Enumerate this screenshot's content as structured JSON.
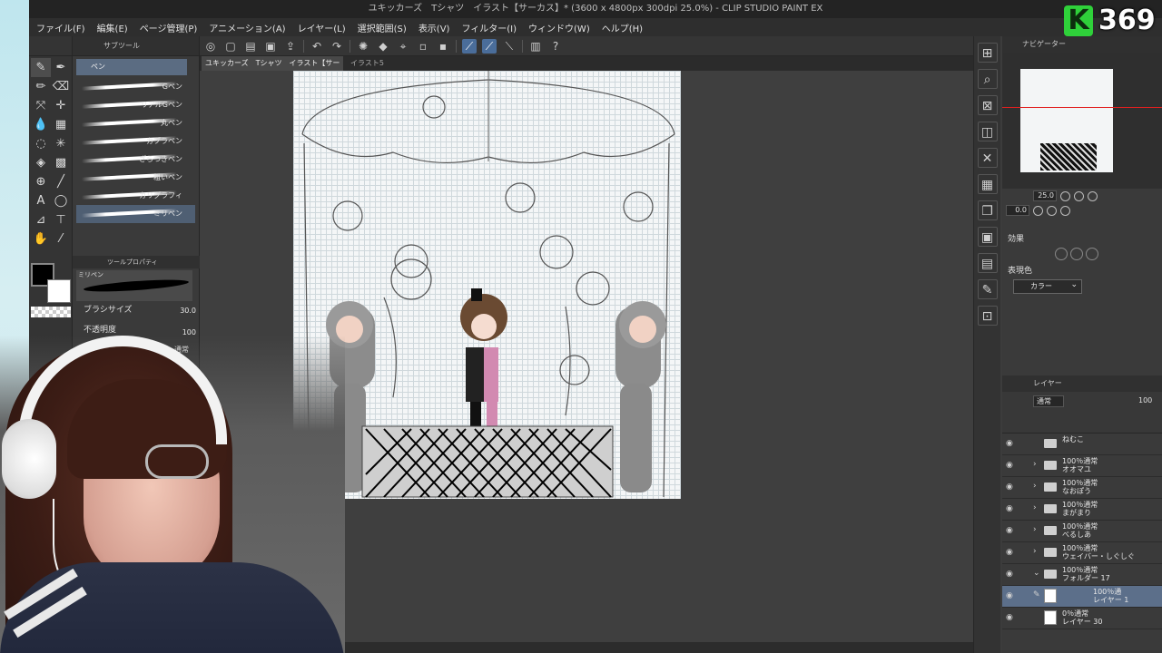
{
  "window": {
    "title": "ユキッカーズ　Tシャツ　イラスト【サーカス】* (3600 x 4800px 300dpi 25.0%) - CLIP STUDIO PAINT EX"
  },
  "menu": [
    "ファイル(F)",
    "編集(E)",
    "ページ管理(P)",
    "アニメーション(A)",
    "レイヤー(L)",
    "選択範囲(S)",
    "表示(V)",
    "フィルター(I)",
    "ウィンドウ(W)",
    "ヘルプ(H)"
  ],
  "subtool_panel": {
    "title": "サブツール",
    "active_tab": "ペン",
    "brushes": [
      "Gペン",
      "リアルGペン",
      "丸ペン",
      "カブラペン",
      "ざらつきペン",
      "粗いペン",
      "カリグラフィ",
      "ミリペン"
    ],
    "selected_brush_index": 7
  },
  "tool_property": {
    "title": "ツールプロパティ",
    "preview_name": "ミリペン",
    "brush_size_label": "ブラシサイズ",
    "brush_size_value": "30.0",
    "opacity_label": "不透明度",
    "opacity_value": "100",
    "blend_value": "通常"
  },
  "document_tabs": [
    {
      "label": "ユキッカーズ　Tシャツ　イラスト【サーカス】*",
      "active": true
    },
    {
      "label": "イラスト5",
      "active": false
    }
  ],
  "navigator": {
    "title": "ナビゲーター",
    "zoom": "25.0",
    "rotation": "0.0"
  },
  "layer_property": {
    "effect_label": "効果",
    "display_color_label": "表現色",
    "display_color_value": "カラー"
  },
  "layers_panel": {
    "title": "レイヤー",
    "blend_mode": "通常",
    "opacity": "100",
    "rows": [
      {
        "line1": "ねむこ",
        "line2": "",
        "type": "folder",
        "selected": false
      },
      {
        "line1": "100％通常",
        "line2": "オオマユ",
        "type": "folder",
        "selected": false
      },
      {
        "line1": "100％通常",
        "line2": "なおぽう",
        "type": "folder",
        "selected": false
      },
      {
        "line1": "100％通常",
        "line2": "まがまり",
        "type": "folder",
        "selected": false
      },
      {
        "line1": "100％通常",
        "line2": "べるしあ",
        "type": "folder",
        "selected": false
      },
      {
        "line1": "100％通常",
        "line2": "ウェイバー・しぐしぐ",
        "type": "folder",
        "selected": false
      },
      {
        "line1": "100％通常",
        "line2": "フォルダー 17",
        "type": "folder",
        "selected": false
      },
      {
        "line1": "100％通",
        "line2": "レイヤー 1",
        "type": "layer",
        "selected": true
      },
      {
        "line1": "0％通常",
        "line2": "レイヤー 30",
        "type": "layer",
        "selected": false
      }
    ]
  },
  "overlay": {
    "logo_letter": "K",
    "logo_number": "369"
  },
  "colors": {
    "accent_selection": "#5c6f8a",
    "main_color": "#000000",
    "sub_color": "#ffffff",
    "logo_green": "#2fd13a"
  }
}
